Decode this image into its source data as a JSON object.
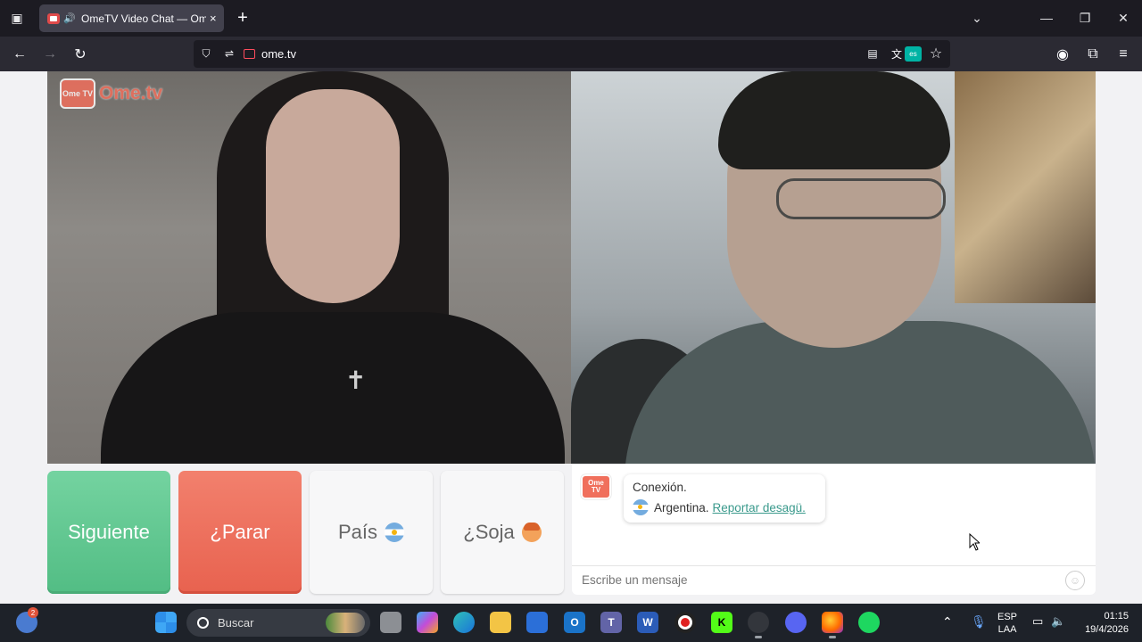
{
  "browser": {
    "tab_title": "OmeTV Video Chat — Ome",
    "tab_close": "×",
    "new_tab": "+",
    "url": "ome.tv",
    "translate_badge": "es"
  },
  "page": {
    "logo_tv_text": "Ome TV",
    "logo_brand": "Ome.tv",
    "buttons": {
      "next": "Siguiente",
      "stop": "¿Parar",
      "country": "País",
      "gender": "¿Soja"
    },
    "chat": {
      "logo_text": "Ome TV",
      "status_line": "Conexión.",
      "country_line": "Argentina.",
      "report_link": "Reportar desagü.",
      "input_placeholder": "Escribe un mensaje"
    }
  },
  "taskbar": {
    "search_label": "Buscar",
    "notification_badge": "2",
    "language_top": "ESP",
    "language_bottom": "LAA",
    "time": "01:15",
    "date": "19/4/2026"
  },
  "colors": {
    "next_button": "#5cc58e",
    "stop_button": "#ec6d59",
    "brand": "#f06f5c",
    "link": "#3a9a8c"
  }
}
